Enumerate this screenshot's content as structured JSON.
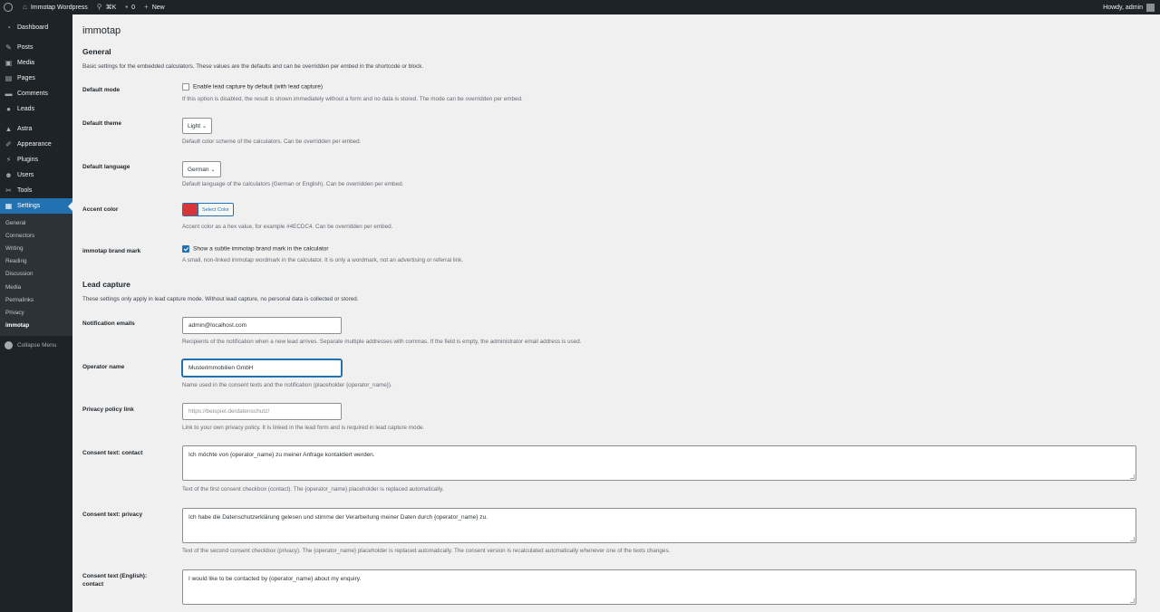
{
  "adminbar": {
    "site_name": "Immotap Wordpress",
    "search_shortcut": "⌘K",
    "comments_count": "0",
    "new_label": "New",
    "howdy": "Howdy, admin"
  },
  "sidebar": {
    "items": [
      {
        "label": "Dashboard",
        "icon": "dashboard-icon"
      },
      {
        "label": "Posts",
        "icon": "pin-icon"
      },
      {
        "label": "Media",
        "icon": "media-icon"
      },
      {
        "label": "Pages",
        "icon": "page-icon"
      },
      {
        "label": "Comments",
        "icon": "comment-icon"
      },
      {
        "label": "Leads",
        "icon": "leads-icon"
      },
      {
        "label": "Astra",
        "icon": "astra-icon"
      },
      {
        "label": "Appearance",
        "icon": "brush-icon"
      },
      {
        "label": "Plugins",
        "icon": "plugin-icon"
      },
      {
        "label": "Users",
        "icon": "users-icon"
      },
      {
        "label": "Tools",
        "icon": "wrench-icon"
      },
      {
        "label": "Settings",
        "icon": "settings-icon"
      }
    ],
    "submenu": [
      "General",
      "Connectors",
      "Writing",
      "Reading",
      "Discussion",
      "Media",
      "Permalinks",
      "Privacy",
      "immotap"
    ],
    "collapse_label": "Collapse Menu"
  },
  "page": {
    "title": "immotap",
    "general": {
      "heading": "General",
      "intro": "Basic settings for the embedded calculators. These values are the defaults and can be overridden per embed in the shortcode or block.",
      "default_mode": {
        "label": "Default mode",
        "checkbox_label": "Enable lead capture by default (with lead capture)",
        "description": "If this option is disabled, the result is shown immediately without a form and no data is stored. The mode can be overridden per embed."
      },
      "default_theme": {
        "label": "Default theme",
        "value": "Light",
        "description": "Default color scheme of the calculators. Can be overridden per embed."
      },
      "default_language": {
        "label": "Default language",
        "value": "German",
        "description": "Default language of the calculators (German or English). Can be overridden per embed."
      },
      "accent_color": {
        "label": "Accent color",
        "color": "#d63638",
        "button_label": "Select Color",
        "description": "Accent color as a hex value, for example #4ECDC4. Can be overridden per embed."
      },
      "brand_mark": {
        "label": "immotap brand mark",
        "checkbox_label": "Show a subtle immotap brand mark in the calculator",
        "description": "A small, non-linked immotap wordmark in the calculator. It is only a wordmark, not an advertising or referral link."
      }
    },
    "lead_capture": {
      "heading": "Lead capture",
      "intro": "These settings only apply in lead capture mode. Without lead capture, no personal data is collected or stored.",
      "notification_emails": {
        "label": "Notification emails",
        "value": "admin@localhost.com",
        "description": "Recipients of the notification when a new lead arrives. Separate multiple addresses with commas. If the field is empty, the administrator email address is used."
      },
      "operator_name": {
        "label": "Operator name",
        "value": "Musterimmobilien GmbH",
        "description": "Name used in the consent texts and the notification (placeholder {operator_name})."
      },
      "privacy_link": {
        "label": "Privacy policy link",
        "placeholder": "https://beispiel.de/datenschutz/",
        "description": "Link to your own privacy policy. It is linked in the lead form and is required in lead capture mode."
      },
      "consent_contact": {
        "label": "Consent text: contact",
        "value": "Ich möchte von {operator_name} zu meiner Anfrage kontaktiert werden.",
        "description": "Text of the first consent checkbox (contact). The {operator_name} placeholder is replaced automatically."
      },
      "consent_privacy": {
        "label": "Consent text: privacy",
        "value": "Ich habe die Datenschutzerklärung gelesen und stimme der Verarbeitung meiner Daten durch {operator_name} zu.",
        "description": "Text of the second consent checkbox (privacy). The {operator_name} placeholder is replaced automatically. The consent version is recalculated automatically whenever one of the texts changes."
      },
      "consent_en_contact": {
        "label": "Consent text (English): contact",
        "value": "I would like to be contacted by {operator_name} about my enquiry."
      }
    }
  }
}
